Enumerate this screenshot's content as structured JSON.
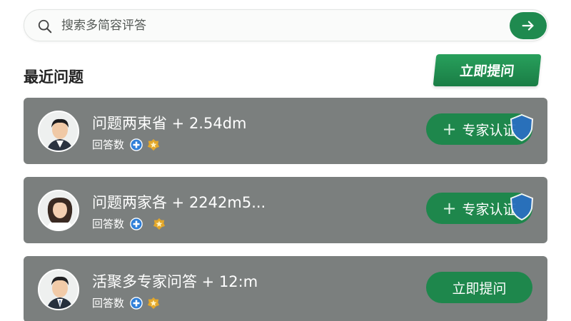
{
  "search": {
    "placeholder": "搜索多简容评答"
  },
  "section": {
    "title": "最近问题",
    "ask_button": "立即提问"
  },
  "questions": [
    {
      "title": "问题两束省 + 2.54dm",
      "answers_label": "回答数",
      "action_label": "专家认证",
      "action_type": "expert-verify"
    },
    {
      "title": "问题两家各 + 2242m5...",
      "answers_label": "回答数",
      "action_label": "专家认证",
      "action_type": "expert-verify"
    },
    {
      "title": "活聚多专家问答 + 12:m",
      "answers_label": "回答数",
      "action_label": "立即提问",
      "action_type": "ask-now"
    }
  ],
  "colors": {
    "accent": "#1f8a4f",
    "card_bg": "#7b7f7e",
    "badge_blue": "#2f7fd8",
    "badge_gold": "#e3a72a"
  }
}
